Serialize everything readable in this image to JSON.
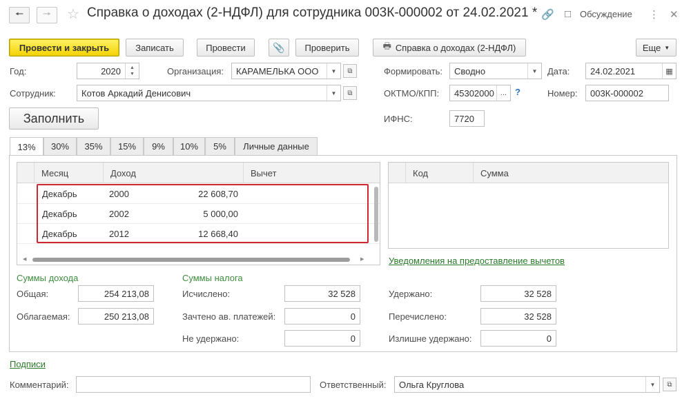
{
  "window": {
    "title": "Справка о доходах (2-НДФЛ) для сотрудника 003К-000002 от 24.02.2021 *",
    "discussion_label": "Обсуждение",
    "back_icon": "arrow-left",
    "forward_icon": "arrow-right"
  },
  "toolbar": {
    "post_close_label": "Провести и закрыть",
    "save_label": "Записать",
    "post_label": "Провести",
    "check_label": "Проверить",
    "report_label": "Справка о доходах (2-НДФЛ)",
    "more_label": "Еще"
  },
  "form": {
    "year_label": "Год:",
    "year_value": "2020",
    "org_label": "Организация:",
    "org_value": "КАРАМЕЛЬКА ООО",
    "form_label": "Формировать:",
    "form_value": "Сводно",
    "date_label": "Дата:",
    "date_value": "24.02.2021",
    "employee_label": "Сотрудник:",
    "employee_value": "Котов Аркадий Денисович",
    "oktmo_label": "ОКТМО/КПП:",
    "oktmo_value": "45302000",
    "oktmo_more": "...",
    "oktmo_help": "?",
    "number_label": "Номер:",
    "number_value": "003К-000002",
    "fill_label": "Заполнить",
    "ifns_label": "ИФНС:",
    "ifns_value": "7720"
  },
  "tabs": [
    {
      "label": "13%"
    },
    {
      "label": "30%"
    },
    {
      "label": "35%"
    },
    {
      "label": "15%"
    },
    {
      "label": "9%"
    },
    {
      "label": "10%"
    },
    {
      "label": "5%"
    },
    {
      "label": "Личные данные"
    }
  ],
  "income_table": {
    "headers": [
      "Месяц",
      "Доход",
      "Вычет"
    ],
    "rows": [
      {
        "month": "Декабрь",
        "code": "2000",
        "amount": "22 608,70",
        "deduction": ""
      },
      {
        "month": "Декабрь",
        "code": "2002",
        "amount": "5 000,00",
        "deduction": ""
      },
      {
        "month": "Декабрь",
        "code": "2012",
        "amount": "12 668,40",
        "deduction": ""
      }
    ]
  },
  "deduction_table": {
    "headers": [
      "Код",
      "Сумма"
    ]
  },
  "notifications_link": "Уведомления на предоставление вычетов",
  "income_sums": {
    "title": "Суммы дохода",
    "total_label": "Общая:",
    "total_value": "254 213,08",
    "taxable_label": "Облагаемая:",
    "taxable_value": "250 213,08"
  },
  "tax_sums": {
    "title": "Суммы налога",
    "calculated_label": "Исчислено:",
    "calculated_value": "32 528",
    "credited_label": "Зачтено ав. платежей:",
    "credited_value": "0",
    "not_withheld_label": "Не удержано:",
    "not_withheld_value": "0",
    "withheld_label": "Удержано:",
    "withheld_value": "32 528",
    "transferred_label": "Перечислено:",
    "transferred_value": "32 528",
    "over_withheld_label": "Излишне удержано:",
    "over_withheld_value": "0"
  },
  "footer": {
    "signatures_link": "Подписи",
    "comment_label": "Комментарий:",
    "comment_value": "",
    "responsible_label": "Ответственный:",
    "responsible_value": "Ольга Круглова"
  },
  "colors": {
    "primary_button": "#f4d200",
    "section_title": "#3d8d3d",
    "highlight_frame": "#d0262f"
  }
}
